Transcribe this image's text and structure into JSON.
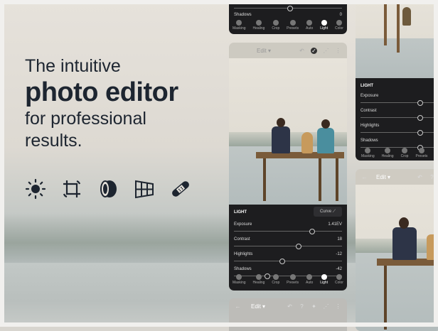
{
  "headline": {
    "line1": "The intuitive",
    "line2": "photo editor",
    "line3": "for professional",
    "line4": "results."
  },
  "feature_icons": [
    "sun-icon",
    "crop-icon",
    "lens-icon",
    "perspective-grid-icon",
    "healing-bandage-icon"
  ],
  "colors": {
    "headline": "#1d2530",
    "panel": "#1d1d1f"
  },
  "top_phone": {
    "shadows_label": "Shadows",
    "shadows_value": "0",
    "toolbar": [
      "Masking",
      "Healing",
      "Crop",
      "Presets",
      "Auto",
      "Light",
      "Color"
    ],
    "active_tool": "Light"
  },
  "main_phone": {
    "title": "Edit",
    "section": "LIGHT",
    "curve_button": "Curve",
    "sliders": [
      {
        "label": "Exposure",
        "value": "1.41EV",
        "position": 0.72
      },
      {
        "label": "Contrast",
        "value": "18",
        "position": 0.59
      },
      {
        "label": "Highlights",
        "value": "-12",
        "position": 0.44
      },
      {
        "label": "Shadows",
        "value": "-42",
        "position": 0.3
      }
    ],
    "toolbar": [
      "Masking",
      "Healing",
      "Crop",
      "Presets",
      "Auto",
      "Light",
      "Color"
    ],
    "active_tool": "Light"
  },
  "bottom_phone": {
    "title": "Edit"
  },
  "right_phone_top": {
    "section": "LIGHT",
    "sliders": [
      {
        "label": "Exposure",
        "position": 0.78
      },
      {
        "label": "Contrast",
        "position": 0.78
      },
      {
        "label": "Highlights",
        "position": 0.78
      },
      {
        "label": "Shadows",
        "position": 0.78
      }
    ],
    "toolbar": [
      "Masking",
      "Healing",
      "Crop",
      "Presets",
      "Pr"
    ]
  },
  "right_phone_bottom": {
    "title": "Edit"
  }
}
